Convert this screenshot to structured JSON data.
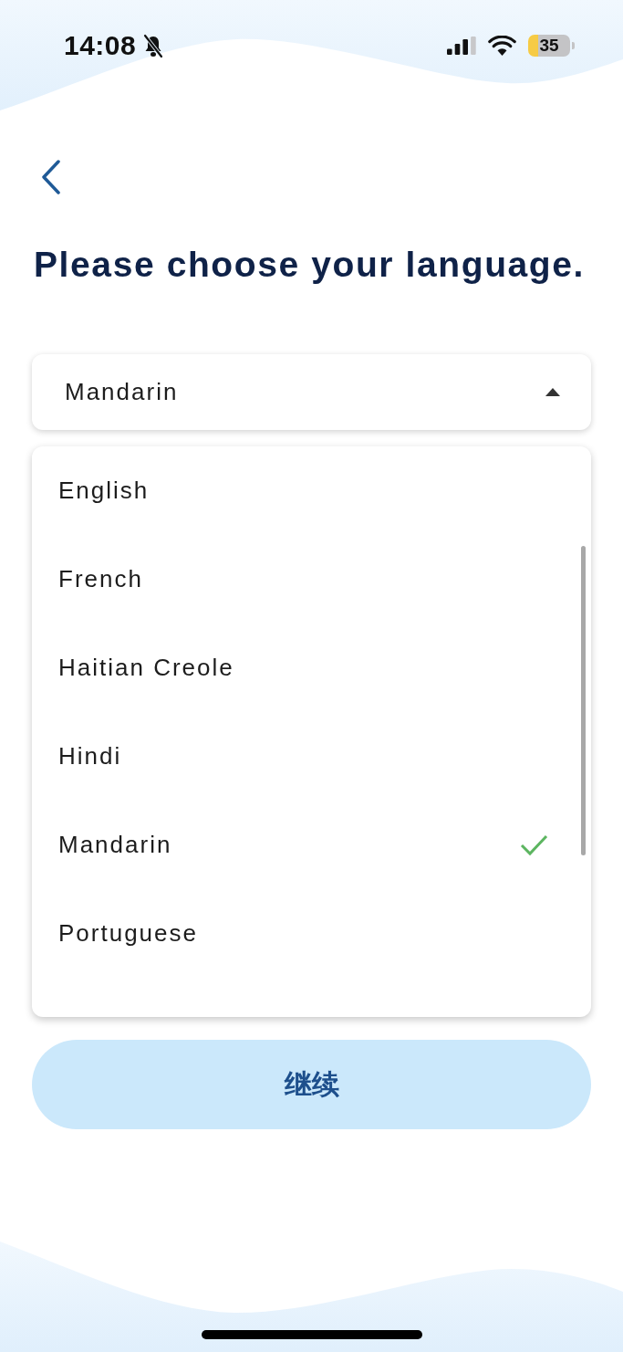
{
  "status_bar": {
    "time": "14:08",
    "silent": true,
    "battery": "35"
  },
  "title": "Please choose your language.",
  "language_select": {
    "value": "Mandarin",
    "expanded": true,
    "options": [
      {
        "label": "English",
        "selected": false
      },
      {
        "label": "French",
        "selected": false
      },
      {
        "label": "Haitian Creole",
        "selected": false
      },
      {
        "label": "Hindi",
        "selected": false
      },
      {
        "label": "Mandarin",
        "selected": true
      },
      {
        "label": "Portuguese",
        "selected": false
      }
    ]
  },
  "continue_button": {
    "label": "继续"
  }
}
